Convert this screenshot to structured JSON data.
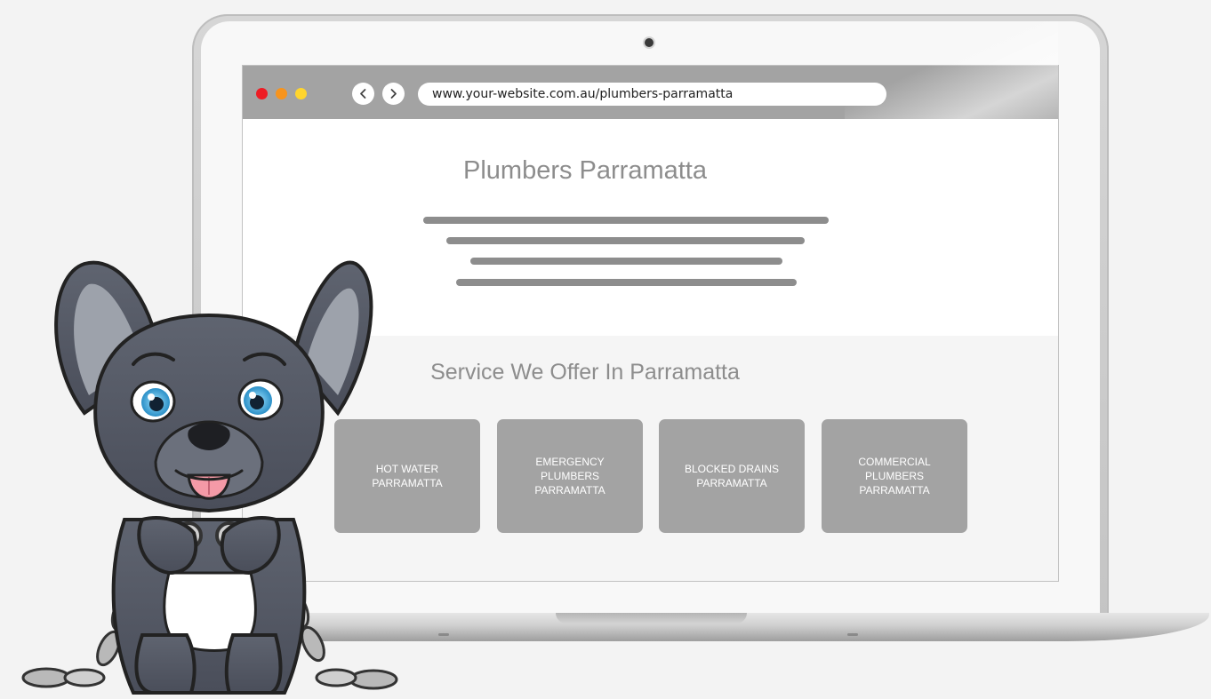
{
  "browser": {
    "url": "www.your-website.com.au/plumbers-parramatta",
    "back_icon": "chevron-left-icon",
    "forward_icon": "chevron-right-icon",
    "traffic_colors": [
      "#ee1c24",
      "#f7941d",
      "#ffd52e"
    ]
  },
  "page": {
    "title": "Plumbers Parramatta",
    "services_title": "Service We Offer In Parramatta",
    "services": [
      {
        "label": "HOT WATER PARRAMATTA"
      },
      {
        "label": "EMERGENCY PLUMBERS PARRAMATTA"
      },
      {
        "label": "BLOCKED DRAINS PARRAMATTA"
      },
      {
        "label": "COMMERCIAL PLUMBERS PARRAMATTA"
      }
    ]
  },
  "mascot": {
    "icon": "french-bulldog-mascot-icon"
  },
  "colors": {
    "browser_bar": "#a3a3a3",
    "text_gray": "#8d8d8d",
    "card_gray": "#a3a3a3"
  }
}
